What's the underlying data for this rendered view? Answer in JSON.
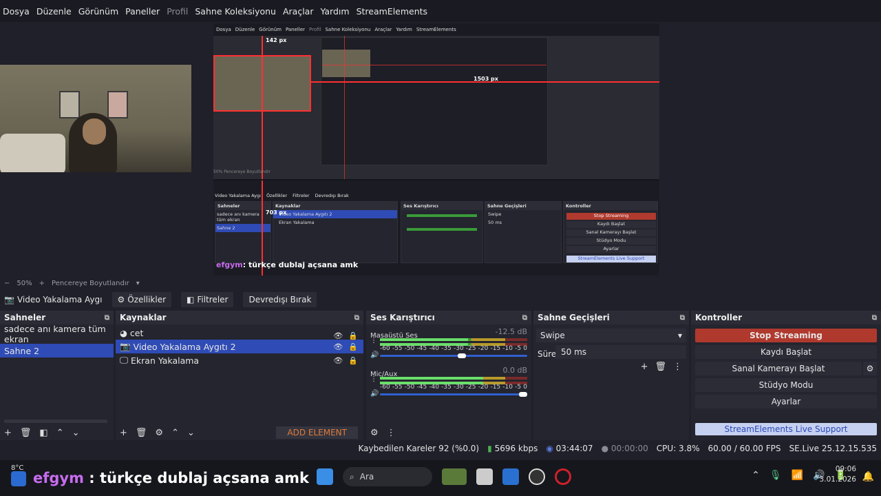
{
  "menu": [
    "Dosya",
    "Düzenle",
    "Görünüm",
    "Paneller",
    "Profil",
    "Sahne Koleksiyonu",
    "Araçlar",
    "Yardım",
    "StreamElements"
  ],
  "preview": {
    "nested_menu": [
      "Dosya",
      "Düzenle",
      "Görünüm",
      "Paneller",
      "Profil",
      "Sahne Koleksiyonu",
      "Araçlar",
      "Yardım",
      "StreamElements"
    ],
    "label_top": "142 px",
    "label_right": "1503 px",
    "label_left": "703 px",
    "nested_zoom": "50%",
    "nested_fit": "Pencereye Boyutlandır",
    "nested_tabs": [
      "Video Yakalama Aygı",
      "Özellikler",
      "Filtreler",
      "Devredışı Bırak"
    ],
    "nested_panels": [
      "Sahneler",
      "Kaynaklar",
      "Ses Karıştırıcı",
      "Sahne Geçişleri",
      "Kontroller"
    ],
    "nested_scenes": [
      "sadece anı kamera tüm ekran",
      "Sahne 2"
    ],
    "nested_sources": [
      "Video Yakalama Aygıtı 2",
      "Ekran Yakalama"
    ],
    "nested_trans": "Swipe",
    "nested_dur": "50 ms",
    "nested_stop": "Stop Streaming",
    "nested_rec": "Kaydı Başlat",
    "nested_vcam": "Sanal Kamerayı Başlat",
    "nested_studio": "Stüdyo Modu",
    "nested_settings": "Ayarlar",
    "nested_support": "StreamElements Live Support",
    "nested_chat_user": "efgym",
    "nested_chat_msg": ": türkçe dublaj açsana amk"
  },
  "zoom": {
    "value": "50%",
    "fit": "Pencereye Boyutlandır"
  },
  "source_bar": {
    "source": "Video Yakalama Aygı",
    "properties": "Özellikler",
    "filters": "Filtreler",
    "disable": "Devredışı Bırak"
  },
  "scenes": {
    "title": "Sahneler",
    "items": [
      "sadece anı kamera tüm ekran",
      "Sahne 2"
    ],
    "selected": 1
  },
  "sources": {
    "title": "Kaynaklar",
    "items": [
      "cet",
      "Video Yakalama Aygıtı 2",
      "Ekran Yakalama"
    ],
    "selected": 1,
    "add_element": "ADD ELEMENT"
  },
  "mixer": {
    "title": "Ses Karıştırıcı",
    "channels": [
      {
        "name": "Masaüstü Ses",
        "db": "-12.5 dB",
        "level": 0.6,
        "volume": 0.56
      },
      {
        "name": "Mic/Aux",
        "db": "0.0 dB",
        "level": 0.7,
        "volume": 1.0
      }
    ],
    "ticks": [
      "-60",
      "-55",
      "-50",
      "-45",
      "-40",
      "-35",
      "-30",
      "-25",
      "-20",
      "-15",
      "-10",
      "-5",
      "0"
    ]
  },
  "transitions": {
    "title": "Sahne Geçişleri",
    "selected": "Swipe",
    "duration_label": "Süre",
    "duration": "50 ms"
  },
  "controls": {
    "title": "Kontroller",
    "stop_streaming": "Stop Streaming",
    "record": "Kaydı Başlat",
    "virtual_cam": "Sanal Kamerayı Başlat",
    "studio": "Stüdyo Modu",
    "settings": "Ayarlar",
    "support": "StreamElements Live Support"
  },
  "status": {
    "dropped": "Kaybedilen Kareler 92 (%0.0)",
    "bitrate": "5696 kbps",
    "stream_time": "03:44:07",
    "rec_time": "00:00:00",
    "cpu": "CPU: 3.8%",
    "fps": "60.00 / 60.00 FPS",
    "version": "SE.Live 25.12.15.535"
  },
  "taskbar": {
    "temp": "8°C",
    "chat_user": "efgym",
    "chat_msg": " : türkçe dublaj açsana amk",
    "search": "Ara",
    "time": "09:06",
    "date": "3.01.2026"
  },
  "colors": {
    "accent": "#2f4bb5",
    "stop": "#b0392e",
    "support_bg": "#c6d0f0"
  }
}
